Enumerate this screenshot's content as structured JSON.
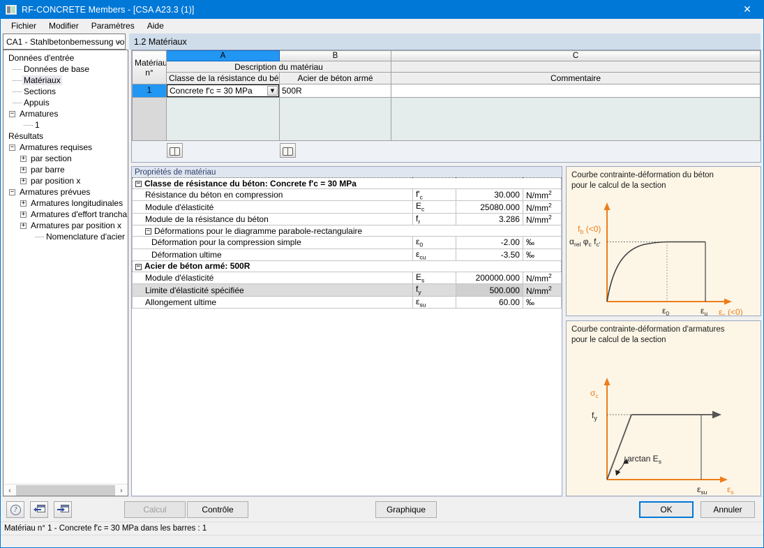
{
  "window": {
    "title": "RF-CONCRETE Members - [CSA A23.3 (1)]",
    "app_icon": "app-window-icon",
    "close_icon": "✕"
  },
  "menu": {
    "items": [
      {
        "label": "Fichier"
      },
      {
        "label": "Modifier"
      },
      {
        "label": "Paramètres"
      },
      {
        "label": "Aide"
      }
    ]
  },
  "nav": {
    "combo_value": "CA1 - Stahlbetonbemessung vo",
    "combo_chevron": "⌄",
    "page_title": "1.2 Matériaux"
  },
  "tree": {
    "items": [
      {
        "label": "Données d'entrée",
        "indent": 0,
        "toggle": "none",
        "selected": false
      },
      {
        "label": "Données de base",
        "indent": 1,
        "toggle": "leaf",
        "selected": false
      },
      {
        "label": "Matériaux",
        "indent": 1,
        "toggle": "leaf",
        "selected": true
      },
      {
        "label": "Sections",
        "indent": 1,
        "toggle": "leaf",
        "selected": false
      },
      {
        "label": "Appuis",
        "indent": 1,
        "toggle": "leaf",
        "selected": false
      },
      {
        "label": "Armatures",
        "indent": 1,
        "toggle": "minus",
        "selected": false
      },
      {
        "label": "1",
        "indent": 2,
        "toggle": "leaf",
        "selected": false
      },
      {
        "label": "Résultats",
        "indent": 0,
        "toggle": "none",
        "selected": false
      },
      {
        "label": "Armatures requises",
        "indent": 1,
        "toggle": "minus",
        "selected": false
      },
      {
        "label": "par section",
        "indent": 2,
        "toggle": "plus",
        "selected": false
      },
      {
        "label": "par barre",
        "indent": 2,
        "toggle": "plus",
        "selected": false
      },
      {
        "label": "par position x",
        "indent": 2,
        "toggle": "plus",
        "selected": false
      },
      {
        "label": "Armatures prévues",
        "indent": 1,
        "toggle": "minus",
        "selected": false
      },
      {
        "label": "Armatures longitudinales",
        "indent": 2,
        "toggle": "plus",
        "selected": false
      },
      {
        "label": "Armatures d'effort trancha",
        "indent": 2,
        "toggle": "plus",
        "selected": false
      },
      {
        "label": "Armatures par position x",
        "indent": 2,
        "toggle": "plus",
        "selected": false
      },
      {
        "label": "Nomenclature d'acier",
        "indent": 2,
        "toggle": "leaf",
        "selected": false
      }
    ],
    "scroll_left_icon": "‹",
    "scroll_right_icon": "›"
  },
  "materials_grid": {
    "column_letters": [
      "A",
      "B",
      "C"
    ],
    "active_column": "A",
    "row_header_line1": "Matériau",
    "row_header_line2": "n°",
    "group_header": "Description du matériau",
    "sub_headers": [
      "Classe de la résistance du béton",
      "Acier de béton armé",
      "Commentaire"
    ],
    "rows": [
      {
        "no": "1",
        "concrete_class": "Concrete f'c = 30 MPa",
        "rebar_steel": "500R",
        "comment": ""
      }
    ],
    "dropdown_icon": "▼",
    "library_button_a": "book-icon",
    "library_button_b": "book-icon"
  },
  "properties": {
    "caption": "Propriétés de matériau",
    "groups": [
      {
        "toggle": "−",
        "title": "Classe de résistance du béton: Concrete f'c = 30 MPa",
        "rows": [
          {
            "label": "Résistance du béton en compression",
            "sym": "f'c",
            "sym_base": "f'",
            "sym_sub": "c",
            "value": "30.000",
            "unit": "N/mm",
            "unit_sup": "2",
            "level": 1,
            "selected": false
          },
          {
            "label": "Module d'élasticité",
            "sym": "Ec",
            "sym_base": "E",
            "sym_sub": "c",
            "value": "25080.000",
            "unit": "N/mm",
            "unit_sup": "2",
            "level": 1,
            "selected": false
          },
          {
            "label": "Module de la résistance du béton",
            "sym": "fr",
            "sym_base": "f",
            "sym_sub": "r",
            "value": "3.286",
            "unit": "N/mm",
            "unit_sup": "2",
            "level": 1,
            "selected": false
          }
        ],
        "subgroup": {
          "toggle": "−",
          "title": "Déformations pour le diagramme parabole-rectangulaire",
          "rows": [
            {
              "label": "Déformation pour la compression simple",
              "sym": "ε0",
              "sym_base": "ε",
              "sym_sub": "0",
              "value": "-2.00",
              "unit": "‰",
              "unit_sup": "",
              "level": 2,
              "selected": false
            },
            {
              "label": "Déformation ultime",
              "sym": "εcu",
              "sym_base": "ε",
              "sym_sub": "cu",
              "value": "-3.50",
              "unit": "‰",
              "unit_sup": "",
              "level": 2,
              "selected": false
            }
          ]
        }
      },
      {
        "toggle": "−",
        "title": "Acier de béton armé: 500R",
        "rows": [
          {
            "label": "Module d'élasticité",
            "sym": "Es",
            "sym_base": "E",
            "sym_sub": "s",
            "value": "200000.000",
            "unit": "N/mm",
            "unit_sup": "2",
            "level": 1,
            "selected": false
          },
          {
            "label": "Limite d'élasticité spécifiée",
            "sym": "fy",
            "sym_base": "f",
            "sym_sub": "y",
            "value": "500.000",
            "unit": "N/mm",
            "unit_sup": "2",
            "level": 1,
            "selected": true
          },
          {
            "label": "Allongement ultime",
            "sym": "εsu",
            "sym_base": "ε",
            "sym_sub": "su",
            "value": "60.00",
            "unit": "‰",
            "unit_sup": "",
            "level": 1,
            "selected": false
          }
        ],
        "subgroup": null
      }
    ]
  },
  "diagram_concrete": {
    "caption_line1": "Courbe contrainte-déformation du béton",
    "caption_line2": "pour le calcul de la section",
    "y_axis_label": "f",
    "y_axis_sub": "b",
    "y_axis_suffix": " (<0)",
    "plateau_label_1": "α",
    "plateau_label_1_sub": "rel",
    "plateau_label_2": "φ",
    "plateau_label_2_sub": "c",
    "plateau_label_3": "f",
    "plateau_label_3_sub": "c'",
    "x_tick_1": "ε",
    "x_tick_1_sub": "0",
    "x_tick_2": "ε",
    "x_tick_2_sub": "u",
    "x_axis_label": "ε",
    "x_axis_sub": "c",
    "x_axis_suffix": " (<0)",
    "accent_color": "#ED7D1B",
    "curve_color": "#404040"
  },
  "diagram_steel": {
    "caption_line1": "Courbe contrainte-déformation d'armatures",
    "caption_line2": "pour le calcul de la section",
    "y_axis_label": "σ",
    "y_axis_sub": "c",
    "y_tick_label": "f",
    "y_tick_sub": "y",
    "slope_label": "arctan E",
    "slope_label_sub": "s",
    "x_tick_1": "ε",
    "x_tick_1_sub": "su",
    "x_axis_label": "ε",
    "x_axis_sub": "s",
    "accent_color": "#ED7D1B",
    "curve_color": "#555555"
  },
  "bottom": {
    "help_icon": "?",
    "prev_icon": "previous-window-icon",
    "next_icon": "next-window-icon",
    "calcul_label": "Calcul",
    "controle_label": "Contrôle",
    "graphique_label": "Graphique",
    "ok_label": "OK",
    "annuler_label": "Annuler"
  },
  "status": {
    "text": "Matériau n° 1  -  Concrete f'c = 30 MPa dans les barres : 1"
  }
}
